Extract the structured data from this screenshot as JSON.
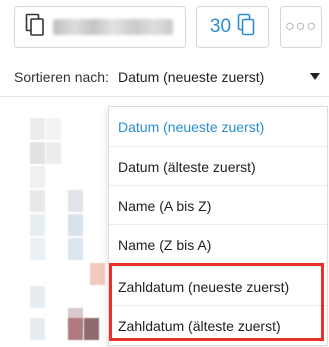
{
  "toolbar": {
    "document_icon": "document-copy-icon",
    "count": "30",
    "count_icon": "document-copy-icon",
    "more_icon": "ellipsis-icon",
    "accent_color": "#2c8ecf"
  },
  "sort": {
    "label": "Sortieren nach:",
    "selected_value": "Datum (neueste zuerst)",
    "options": [
      {
        "label": "Datum (neueste zuerst)",
        "selected": true
      },
      {
        "label": "Datum (älteste zuerst)",
        "selected": false
      },
      {
        "label": "Name (A bis Z)",
        "selected": false
      },
      {
        "label": "Name (Z bis A)",
        "selected": false
      },
      {
        "label": "Zahldatum (neueste zuerst)",
        "selected": false
      },
      {
        "label": "Zahldatum (älteste zuerst)",
        "selected": false
      }
    ]
  },
  "annotation": {
    "highlight_color": "#e8312a"
  }
}
